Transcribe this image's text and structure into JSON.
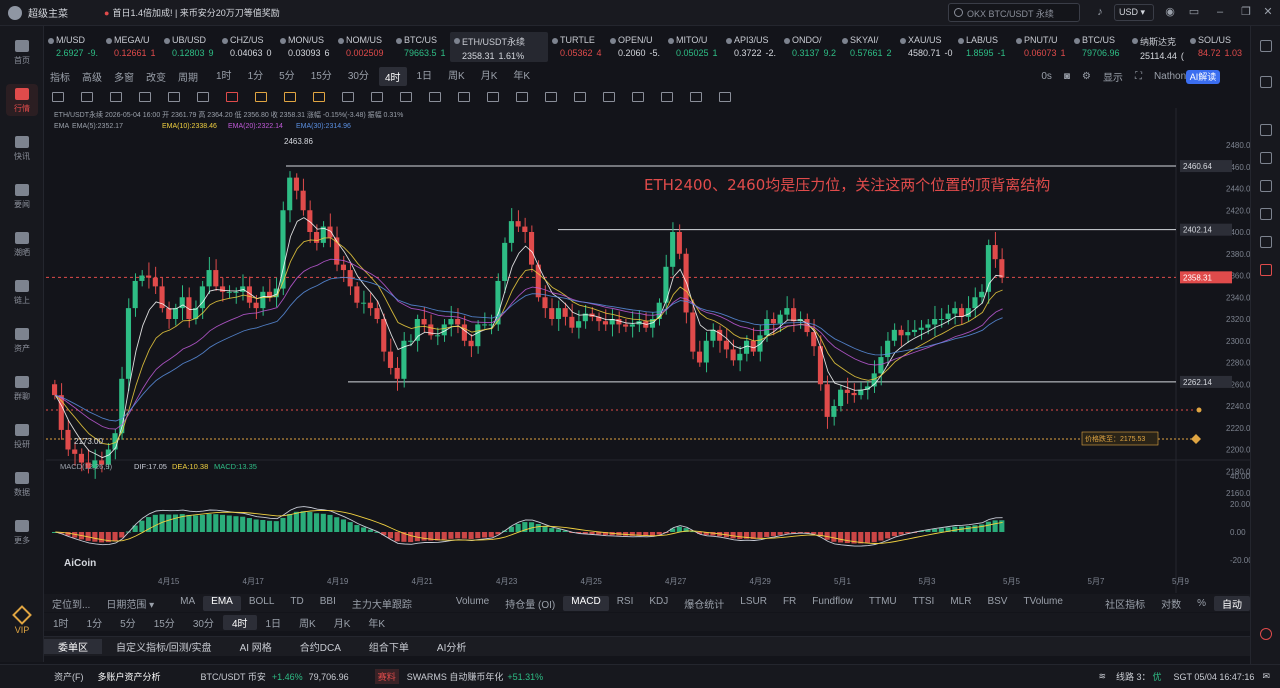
{
  "titlebar": {
    "app_name": "超级主菜",
    "notice1": "首日1.4倍加成!",
    "notice2": "来币安分20万刀等值奖励",
    "search_placeholder": "OKX BTC/USDT 永续",
    "currency": "USD"
  },
  "sidebar": {
    "items": [
      "首页",
      "行情",
      "快讯",
      "要闻",
      "潮晒",
      "链上",
      "资产",
      "群聊",
      "投研",
      "数据",
      "更多"
    ],
    "active": "行情",
    "vip": "VIP"
  },
  "ticker": [
    {
      "name": "M/USD",
      "price": "2.6927",
      "chg": "-9.",
      "dir": "up"
    },
    {
      "name": "MEGA/U",
      "price": "0.12661",
      "chg": "1",
      "dir": "dn"
    },
    {
      "name": "UB/USD",
      "price": "0.12803",
      "chg": "9",
      "dir": "up"
    },
    {
      "name": "CHZ/US",
      "price": "0.04063",
      "chg": "0",
      "dir": "wh"
    },
    {
      "name": "MON/US",
      "price": "0.03093",
      "chg": "6",
      "dir": "wh"
    },
    {
      "name": "NOM/US",
      "price": "0.002509",
      "chg": "",
      "dir": "dn"
    },
    {
      "name": "BTC/US",
      "price": "79663.5",
      "chg": "1",
      "dir": "up"
    },
    {
      "name": "ETH/USDT永续",
      "price": "2358.31",
      "chg": "1.61%",
      "dir": "wh",
      "selected": true
    },
    {
      "name": "TURTLE",
      "price": "0.05362",
      "chg": "4",
      "dir": "dn"
    },
    {
      "name": "OPEN/U",
      "price": "0.2060",
      "chg": "-5.",
      "dir": "wh"
    },
    {
      "name": "MITO/U",
      "price": "0.05025",
      "chg": "1",
      "dir": "up"
    },
    {
      "name": "API3/US",
      "price": "0.3722",
      "chg": "-2.",
      "dir": "wh"
    },
    {
      "name": "ONDO/",
      "price": "0.3137",
      "chg": "9.2",
      "dir": "up"
    },
    {
      "name": "SKYAI/",
      "price": "0.57661",
      "chg": "2",
      "dir": "up"
    },
    {
      "name": "XAU/US",
      "price": "4580.71",
      "chg": "-0",
      "dir": "wh"
    },
    {
      "name": "LAB/US",
      "price": "1.8595",
      "chg": "-1",
      "dir": "up"
    },
    {
      "name": "PNUT/U",
      "price": "0.06073",
      "chg": "1",
      "dir": "dn"
    },
    {
      "name": "BTC/US",
      "price": "79706.96",
      "chg": "",
      "dir": "up"
    },
    {
      "name": "纳斯达克",
      "price": "25114.44",
      "chg": "(",
      "dir": "wh"
    },
    {
      "name": "SOL/US",
      "price": "84.72",
      "chg": "1.03",
      "dir": "dn"
    }
  ],
  "timeframes": {
    "tools": [
      "指标",
      "高级",
      "多窗",
      "改变",
      "周期"
    ],
    "periods": [
      "1时",
      "1分",
      "5分",
      "15分",
      "30分",
      "4时",
      "1日",
      "周K",
      "月K",
      "年K"
    ],
    "selected": "4时",
    "right": [
      "0s",
      "显示"
    ],
    "user": "Nathon",
    "ai_button": "AI解读"
  },
  "chart": {
    "symbol_line": "ETH/USDT永续  2026-05-04 16:00  开 2361.79  高 2364.20  低 2356.80  收 2358.31  涨幅 -0.15%(-3.48)  振幅 0.31%",
    "ema_label": "EMA",
    "ema5": "EMA(5):2352.17",
    "ema10": "EMA(10):2338.46",
    "ema20": "EMA(20):2322.14",
    "ema30": "EMA(30):2314.96",
    "annotation": "ETH2400、2460均是压力位，关注这两个位置的顶背离结构",
    "high_label": "2463.86",
    "low_label": "2173.00",
    "price_tags": {
      "top": "2460.64",
      "res": "2402.14",
      "current": "2358.31",
      "sup": "2262.14"
    },
    "alert_label": "价格跌至：2175.53",
    "y_ticks": [
      "2480.00",
      "2460.00",
      "2440.00",
      "2420.00",
      "2400.00",
      "2380.00",
      "2360.00",
      "2340.00",
      "2320.00",
      "2300.00",
      "2280.00",
      "2260.00",
      "2240.00",
      "2220.00",
      "2200.00",
      "2180.00",
      "2160.00"
    ],
    "macd_label": "MACD(12,26,9)",
    "dif": "DIF:17.05",
    "dea": "DEA:10.38",
    "macd": "MACD:13.35",
    "macd_ticks": [
      "40.00",
      "20.00",
      "0.00",
      "-20.00"
    ],
    "x_ticks": [
      "4月15",
      "4月17",
      "4月19",
      "4月21",
      "4月23",
      "4月25",
      "4月27",
      "4月29",
      "5月1",
      "5月3",
      "5月5",
      "5月7",
      "5月9"
    ],
    "watermark": "AiCoin",
    "colors": {
      "up": "#2ebd85",
      "down": "#e04b4b",
      "ema5": "#ffffff",
      "ema10": "#f0d040",
      "ema20": "#c05ad8",
      "ema30": "#5a8fe0",
      "annotation": "#e04b4b",
      "current": "#e04b4b",
      "alert": "#e0a542"
    }
  },
  "indicators": {
    "left": [
      "定位到...",
      "日期范围"
    ],
    "main": [
      "MA",
      "EMA",
      "BOLL",
      "TD",
      "BBI",
      "主力大单跟踪"
    ],
    "main_selected": "EMA",
    "sub": [
      "Volume",
      "持仓量 (OI)",
      "MACD",
      "RSI",
      "KDJ",
      "爆仓统计",
      "LSUR",
      "FR",
      "Fundflow",
      "TTMU",
      "TTSI",
      "MLR",
      "BSV",
      "TVolume"
    ],
    "sub_selected": "MACD",
    "right": [
      "社区指标",
      "对数",
      "%",
      "自动"
    ]
  },
  "periods2": [
    "1时",
    "1分",
    "5分",
    "15分",
    "30分",
    "4时",
    "1日",
    "周K",
    "月K",
    "年K"
  ],
  "periods2_selected": "4时",
  "tabs": [
    "委单区",
    "自定义指标/回测/实盘",
    "AI 网格",
    "合约DCA",
    "组合下单",
    "AI分析"
  ],
  "tab_selected": "委单区",
  "statusbar": {
    "asset": "资产(F)",
    "multi": "多账户资产分析",
    "btc": "BTC/USDT 币安",
    "btc_chg": "+1.46%",
    "btc_price": "79,706.96",
    "tag": "赛料",
    "swarms": "SWARMS 自动赚币年化",
    "swarms_val": "+51.31%",
    "line": "线路 3：",
    "line_q": "优",
    "time": "SGT 05/04 16:47:16"
  }
}
